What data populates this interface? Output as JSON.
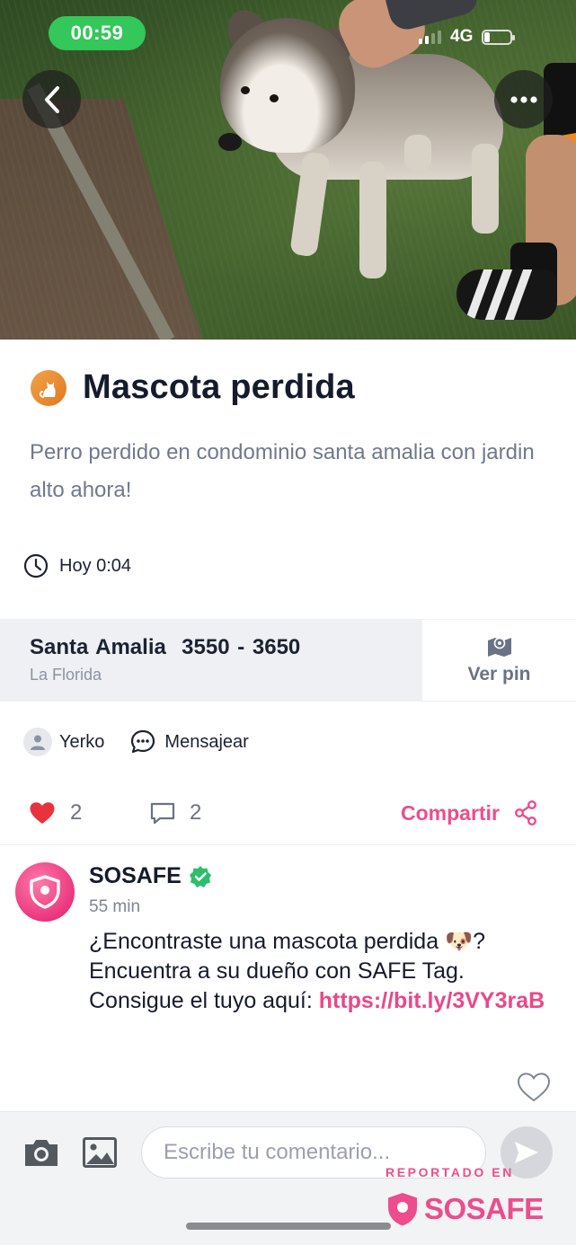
{
  "status_bar": {
    "time": "00:59",
    "network": "4G"
  },
  "post": {
    "category_icon": "cat-icon",
    "title": "Mascota perdida",
    "description": "Perro perdido en condominio santa amalia con jardin alto ahora!",
    "time": "Hoy 0:04",
    "location": {
      "street": "Santa Amalia  3550 - 3650",
      "city": "La Florida"
    },
    "pin_button": "Ver pin",
    "author": "Yerko",
    "message_button": "Mensajear",
    "likes": "2",
    "comments": "2",
    "share_button": "Compartir"
  },
  "comment": {
    "author": "SOSAFE",
    "verified": true,
    "time": "55 min",
    "text": "¿Encontraste una mascota perdida 🐶? Encuentra a su dueño con SAFE Tag. Consigue el tuyo aquí: ",
    "link": "https://bit.ly/3VY3raB"
  },
  "composer": {
    "placeholder": "Escribe tu comentario..."
  },
  "watermark": {
    "label": "REPORTADO EN",
    "brand": "SOSAFE"
  },
  "colors": {
    "accent": "#EC4D8C",
    "like_red": "#E8323C",
    "status_green": "#34C759",
    "verified_green": "#2DBE6C"
  }
}
